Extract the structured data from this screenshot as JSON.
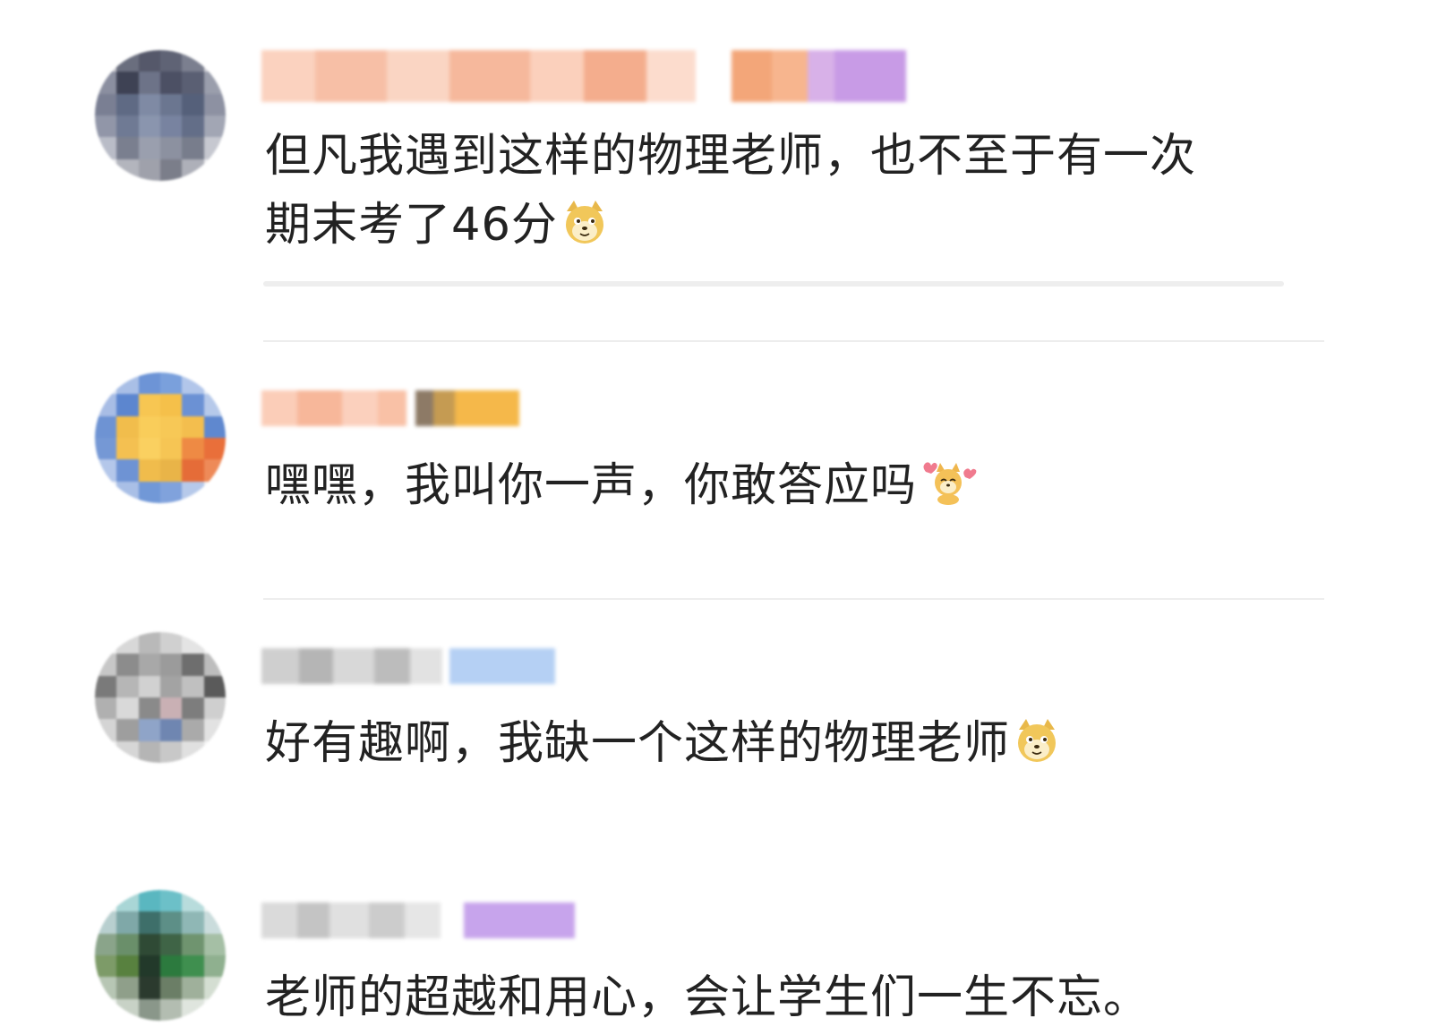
{
  "comments": [
    {
      "text_lines": [
        "但凡我遇到这样的物理老师，也不至于有一次",
        "期末考了46分"
      ],
      "emoji": "doge-icon"
    },
    {
      "text_lines": [
        "嘿嘿，我叫你一声，你敢答应吗"
      ],
      "emoji": "dog-cheer-icon"
    },
    {
      "text_lines": [
        "好有趣啊，我缺一个这样的物理老师"
      ],
      "emoji": "doge-icon"
    },
    {
      "text_lines": [
        "老师的超越和用心，会让学生们一生不忘。"
      ],
      "emoji": null
    }
  ],
  "colors": {
    "text": "#222222",
    "divider": "#ededed",
    "background": "#ffffff"
  }
}
